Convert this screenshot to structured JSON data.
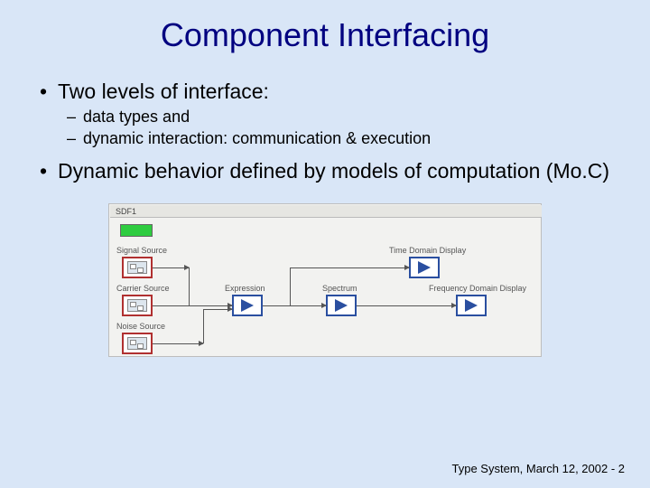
{
  "title": "Component Interfacing",
  "bullet1": "Two levels of interface:",
  "sub1a": "data types and",
  "sub1b": "dynamic interaction: communication & execution",
  "bullet2": "Dynamic behavior defined by models of computation (Mo.C)",
  "diagram": {
    "toolbar": "SDF1",
    "signal_source": "Signal Source",
    "carrier_source": "Carrier Source",
    "noise_source": "Noise Source",
    "expression": "Expression",
    "spectrum": "Spectrum",
    "time_display": "Time Domain Display",
    "freq_display": "Frequency Domain Display"
  },
  "footer": "Type System, March 12, 2002 - 2"
}
